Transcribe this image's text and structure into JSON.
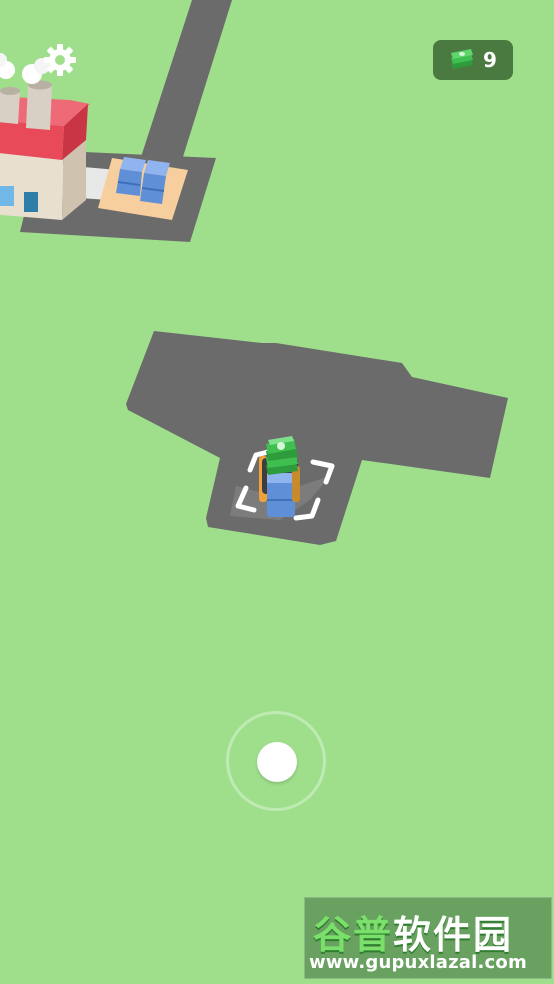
{
  "hud": {
    "money_icon": "cash-stack-icon",
    "money_value": "9",
    "settings_icon": "gear-icon"
  },
  "scene": {
    "ground_color": "#9fdf8c",
    "road_color": "#6b6b6b",
    "factory_roof_color": "#e84a5a",
    "box_color": "#5f8fd6",
    "cash_color": "#3fbf4f"
  },
  "joystick": {
    "ring_icon": "joystick-ring",
    "knob_icon": "joystick-knob"
  },
  "watermark": {
    "title_part1": "谷普",
    "title_part2": "软件园",
    "url": "www.gupuxlazal.com"
  }
}
